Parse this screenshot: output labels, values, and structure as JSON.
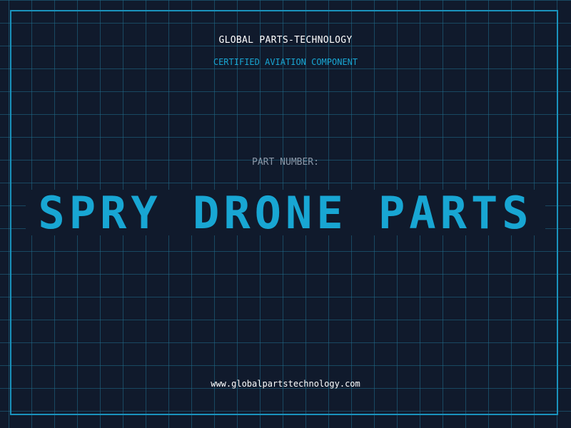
{
  "header": {
    "brand": "GLOBAL PARTS-TECHNOLOGY",
    "tagline": "CERTIFIED AVIATION COMPONENT"
  },
  "main": {
    "label": "PART NUMBER:",
    "part_number": "SPRY DRONE PARTS"
  },
  "footer": {
    "url": "www.globalpartstechnology.com"
  },
  "colors": {
    "background": "#101a2c",
    "grid": "#216e8c",
    "accent": "#18a6d3",
    "label": "#8b98a8",
    "text": "#ffffff"
  }
}
